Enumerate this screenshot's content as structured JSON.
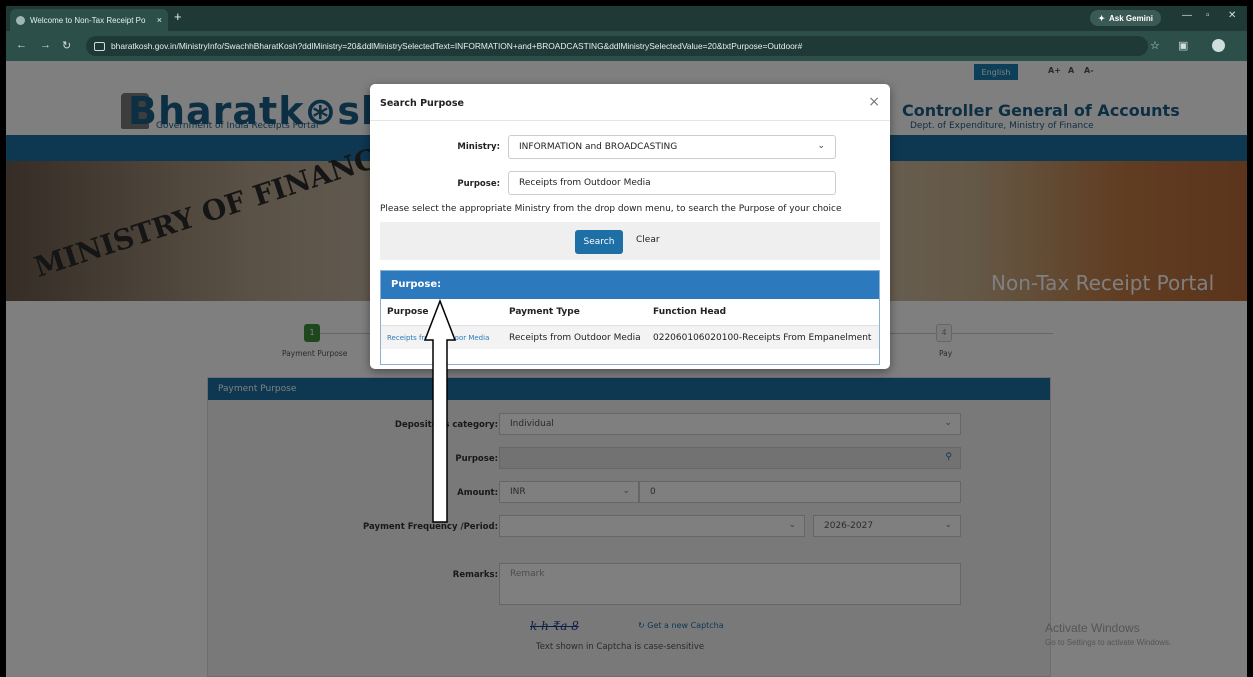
{
  "browser": {
    "tab_title": "Welcome to Non-Tax Receipt Po",
    "tab_close": "×",
    "new_tab": "+",
    "gemini": "Ask Gemini",
    "url": "bharatkosh.gov.in/MinistryInfo/SwachhBharatKosh?ddlMinistry=20&ddlMinistrySelectedText=INFORMATION+and+BROADCASTING&ddlMinistrySelectedValue=20&txtPurpose=Outdoor#"
  },
  "site": {
    "lang": "English",
    "font_sizes": [
      "A+",
      "A",
      "A-"
    ],
    "logo": "Bharatk⊛sh",
    "logo_sub": "Government of India Receipts Portal",
    "cga_title": "Controller General of Accounts",
    "cga_sub": "Dept. of Expenditure, Ministry of Finance",
    "banner_left": "MINISTRY OF FINANCE",
    "banner_right": "Non-Tax Receipt Portal",
    "step1_num": "1",
    "step1_label": "Payment Purpose",
    "step_last_num": "4",
    "step_last_label": "Pay",
    "form_title": "Payment Purpose",
    "form": {
      "depositor_label": "Depositor's category:",
      "depositor_value": "Individual",
      "purpose_label": "Purpose:",
      "amount_label": "Amount:",
      "amount_currency": "INR",
      "amount_value": "0",
      "frequency_label": "Payment Frequency /Period:",
      "frequency_year": "2026-2027",
      "remarks_label": "Remarks:",
      "remarks_placeholder": "Remark",
      "captcha_text": "k h ₹a 8",
      "captcha_refresh": "Get a new Captcha",
      "captcha_hint": "Text shown in Captcha is case-sensitive"
    },
    "watermark_title": "Activate Windows",
    "watermark_sub": "Go to Settings to activate Windows."
  },
  "modal": {
    "title": "Search Purpose",
    "close": "×",
    "ministry_label": "Ministry:",
    "ministry_value": "INFORMATION and BROADCASTING",
    "purpose_label": "Purpose:",
    "purpose_value": "Receipts from Outdoor Media",
    "hint": "Please select the appropriate Ministry from the drop down menu, to search the Purpose of your choice",
    "search_btn": "Search",
    "clear_btn": "Clear",
    "results_title": "Purpose:",
    "columns": [
      "Purpose",
      "Payment Type",
      "Function Head"
    ],
    "rows": [
      {
        "purpose": "Receipts from Outdoor Media",
        "payment_type": "Receipts from Outdoor Media",
        "function_head": "022060106020100-Receipts From Empanelment"
      }
    ]
  },
  "colors": {
    "accent": "#1d6fa5",
    "results_header": "#2d79bd",
    "browser_chrome": "#2c4f4a"
  }
}
